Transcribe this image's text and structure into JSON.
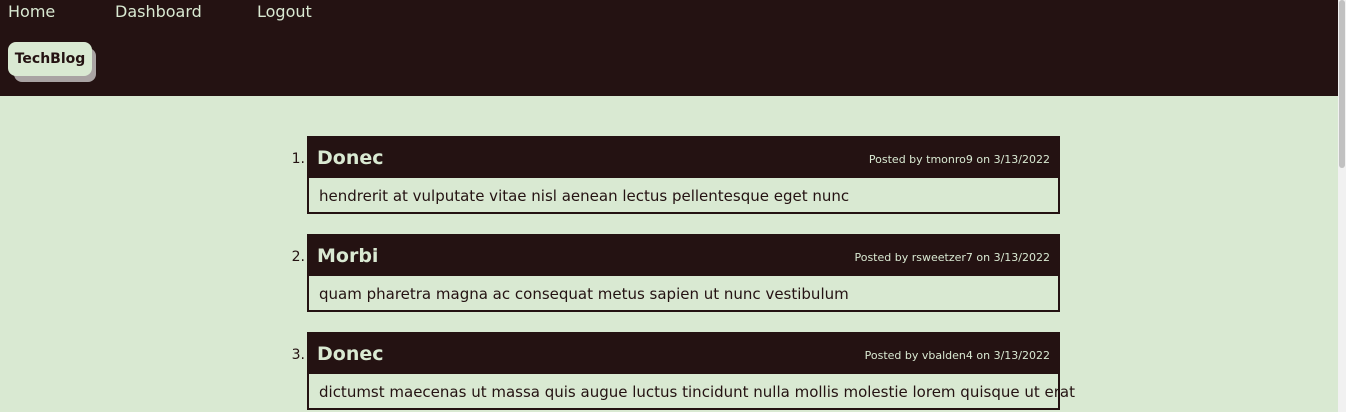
{
  "nav": {
    "home": "Home",
    "dashboard": "Dashboard",
    "logout": "Logout"
  },
  "logo": "TechBlog",
  "posts": [
    {
      "number": "1.",
      "title": "Donec",
      "meta": "Posted by tmonro9 on 3/13/2022",
      "body": "hendrerit at vulputate vitae nisl aenean lectus pellentesque eget nunc"
    },
    {
      "number": "2.",
      "title": "Morbi",
      "meta": "Posted by rsweetzer7 on 3/13/2022",
      "body": "quam pharetra magna ac consequat metus sapien ut nunc vestibulum"
    },
    {
      "number": "3.",
      "title": "Donec",
      "meta": "Posted by vbalden4 on 3/13/2022",
      "body": "dictumst maecenas ut massa quis augue luctus tincidunt nulla mollis molestie lorem quisque ut erat"
    }
  ],
  "colors": {
    "background": "#d9e9d2",
    "header": "#241212"
  }
}
